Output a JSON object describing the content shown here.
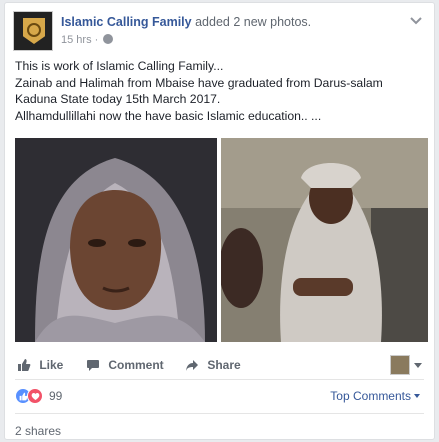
{
  "post": {
    "page_name": "Islamic Calling Family",
    "action_text": "added 2 new photos.",
    "time": "15 hrs",
    "meta_separator": "·",
    "lines": [
      "This is work of Islamic Calling Family...",
      "Zainab and Halimah from Mbaise have graduated from Darus-salam",
      "Kaduna State today 15th March 2017.",
      "Allhamdullillahi now the have basic Islamic education.. ..."
    ]
  },
  "actions": {
    "like": "Like",
    "comment": "Comment",
    "share": "Share"
  },
  "reactions": {
    "count": "99",
    "types": [
      "like",
      "love"
    ],
    "top_comments": "Top Comments"
  },
  "shares": "2 shares",
  "icons": {
    "avatar": "page-avatar-icon",
    "globe": "globe-icon",
    "chevron": "chevron-down-icon",
    "like": "thumbs-up-icon",
    "comment": "comment-bubble-icon",
    "share": "share-arrow-icon"
  },
  "colors": {
    "link": "#365899",
    "secondary_text": "#606770",
    "like_reaction": "#5890ff",
    "love_reaction": "#f25268"
  }
}
